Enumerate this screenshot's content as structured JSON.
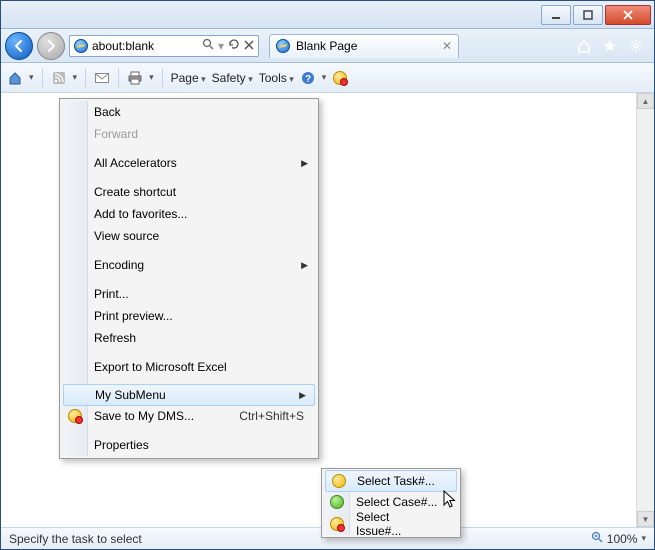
{
  "window": {
    "address": "about:blank",
    "tab_title": "Blank Page"
  },
  "cmdbar": {
    "page": "Page",
    "safety": "Safety",
    "tools": "Tools"
  },
  "context_menu": {
    "back": "Back",
    "forward": "Forward",
    "all_accelerators": "All Accelerators",
    "create_shortcut": "Create shortcut",
    "add_to_favorites": "Add to favorites...",
    "view_source": "View source",
    "encoding": "Encoding",
    "print": "Print...",
    "print_preview": "Print preview...",
    "refresh": "Refresh",
    "export_excel": "Export to Microsoft Excel",
    "my_submenu": "My SubMenu",
    "save_to_dms": "Save to My DMS...",
    "save_to_dms_shortcut": "Ctrl+Shift+S",
    "properties": "Properties"
  },
  "submenu": {
    "select_task": "Select Task#...",
    "select_case": "Select Case#...",
    "select_issue": "Select Issue#..."
  },
  "statusbar": {
    "message": "Specify the task to select",
    "zoom": "100%"
  }
}
